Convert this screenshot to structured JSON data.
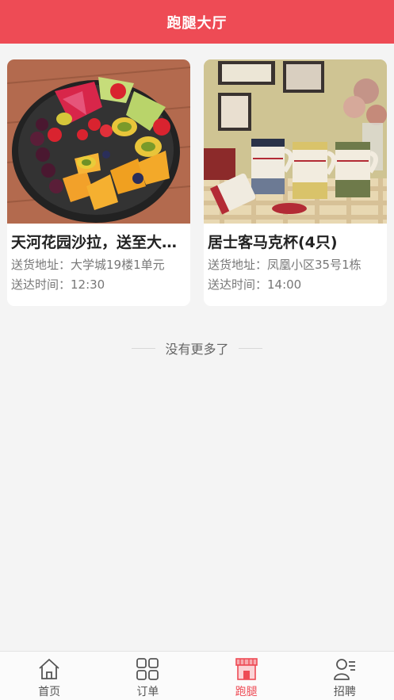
{
  "header": {
    "title": "跑腿大厅"
  },
  "cards": [
    {
      "name": "天河花园沙拉，送至大学城",
      "address": "送货地址：大学城19楼1单元",
      "time": "送达时间：12:30"
    },
    {
      "name": "居士客马克杯(4只)",
      "address": "送货地址：凤凰小区35号1栋",
      "time": "送达时间：14:00"
    }
  ],
  "end_note": "没有更多了",
  "tabbar": {
    "active_color": "#ee4b55",
    "items": [
      {
        "label": "首页",
        "icon": "home-icon"
      },
      {
        "label": "订单",
        "icon": "grid-icon"
      },
      {
        "label": "跑腿",
        "icon": "storefront-icon"
      },
      {
        "label": "招聘",
        "icon": "person-list-icon"
      }
    ]
  }
}
